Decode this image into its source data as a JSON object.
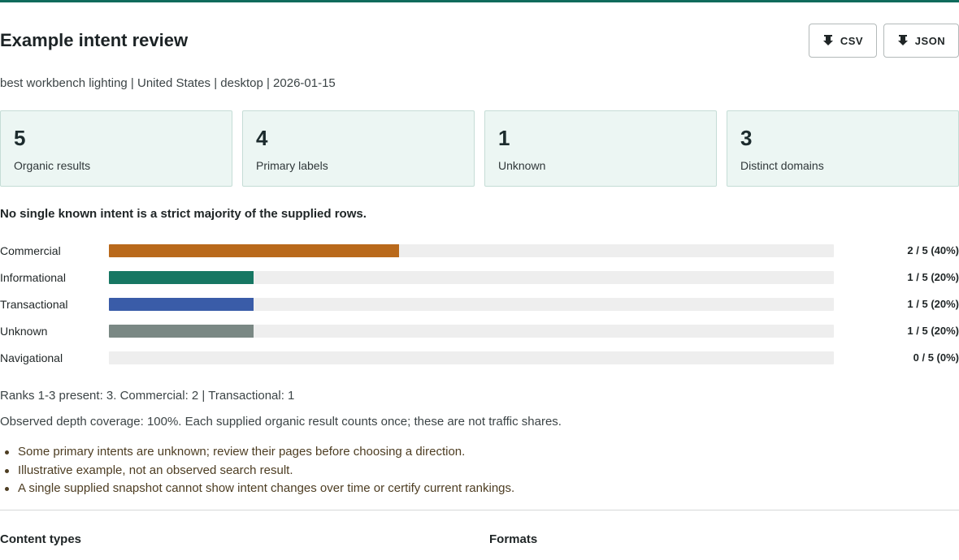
{
  "header": {
    "title": "Example intent review",
    "buttons": [
      {
        "label": "CSV",
        "icon": "download-icon"
      },
      {
        "label": "JSON",
        "icon": "download-icon"
      }
    ],
    "meta": "best workbench lighting | United States | desktop | 2026-01-15"
  },
  "stats": [
    {
      "value": "5",
      "label": "Organic results"
    },
    {
      "value": "4",
      "label": "Primary labels"
    },
    {
      "value": "1",
      "label": "Unknown"
    },
    {
      "value": "3",
      "label": "Distinct domains"
    }
  ],
  "verdict": "No single known intent is a strict majority of the supplied rows.",
  "intents": [
    {
      "name": "Commercial",
      "count": "2 / 5 (40%)",
      "share": 0.4,
      "color": "#b9691b"
    },
    {
      "name": "Informational",
      "count": "1 / 5 (20%)",
      "share": 0.2,
      "color": "#177763"
    },
    {
      "name": "Transactional",
      "count": "1 / 5 (20%)",
      "share": 0.2,
      "color": "#3a5ca8"
    },
    {
      "name": "Unknown",
      "count": "1 / 5 (20%)",
      "share": 0.2,
      "color": "#7a8884"
    },
    {
      "name": "Navigational",
      "count": "0 / 5 (0%)",
      "share": 0,
      "color": "#8a8f8f"
    }
  ],
  "notes": {
    "ranks": "Ranks 1-3 present: 3. Commercial: 2 | Transactional: 1",
    "coverage": "Observed depth coverage: 100%. Each supplied organic result counts once; these are not traffic shares."
  },
  "caveats": [
    "Some primary intents are unknown; review their pages before choosing a direction.",
    "Illustrative example, not an observed search result.",
    "A single supplied snapshot cannot show intent changes over time or certify current rankings."
  ],
  "sections": {
    "content_types": "Content types",
    "formats": "Formats"
  },
  "colors": {
    "accent": "#0f6b5c",
    "card_background": "#ecf6f3",
    "caveat_text": "#4d3d22"
  }
}
